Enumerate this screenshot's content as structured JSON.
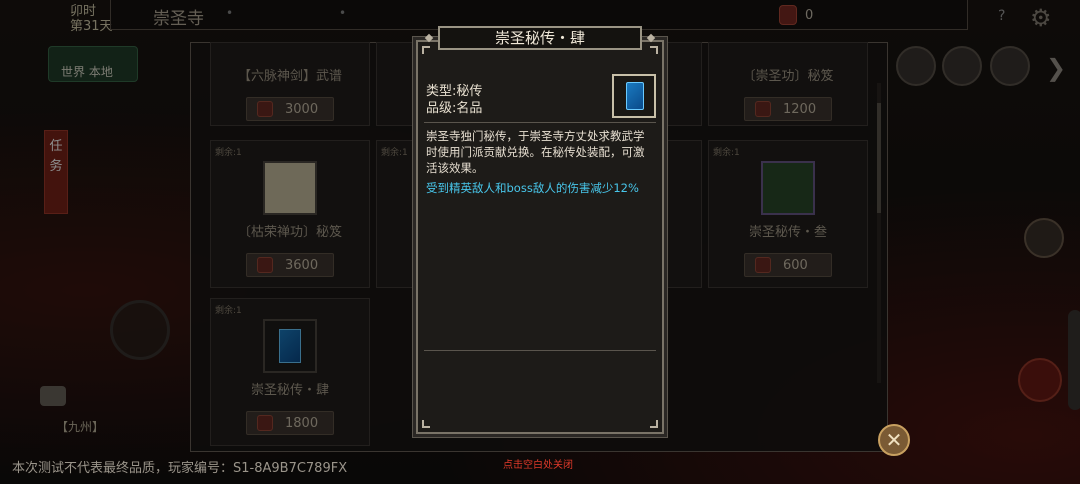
{
  "topbar": {
    "title": "崇圣寺",
    "currency_value": "0"
  },
  "left": {
    "time_line1": "卯时",
    "time_line2": "第31天",
    "world_btn": "世界 本地",
    "task_tab": "任务",
    "region": "【九州】"
  },
  "shop": {
    "cards": [
      {
        "remain": "",
        "name": "【六脉神剑】武谱",
        "price": "3000"
      },
      {
        "remain": "",
        "name": "",
        "price": ""
      },
      {
        "remain": "",
        "name": "",
        "price": ""
      },
      {
        "remain": "",
        "name": "〔崇圣功〕秘笈",
        "price": "1200"
      },
      {
        "remain": "剩余:1",
        "name": "〔枯荣禅功〕秘笈",
        "price": "3600"
      },
      {
        "remain": "剩余:1",
        "name": "",
        "price": ""
      },
      {
        "remain": "",
        "name": "",
        "price": ""
      },
      {
        "remain": "剩余:1",
        "name": "崇圣秘传・叁",
        "price": "600"
      },
      {
        "remain": "剩余:1",
        "name": "崇圣秘传・肆",
        "price": "1800"
      }
    ]
  },
  "popup": {
    "title": "崇圣秘传・肆",
    "type_label": "类型:",
    "type_value": "秘传",
    "grade_label": "品级:",
    "grade_value": "名品",
    "description": "崇圣寺独门秘传，于崇圣寺方丈处求教武学时使用门派贡献兑换。在秘传处装配，可激活该效果。",
    "effect": "受到精英敌人和boss敌人的伤害减少12%"
  },
  "hint": "点击空白处关闭",
  "watermark": "本次测试不代表最终品质，玩家编号：S1-8A9B7C789FX",
  "colors": {
    "effect": "#48c6ea",
    "hint": "#e03a2a",
    "accent_red": "#7a2418"
  }
}
